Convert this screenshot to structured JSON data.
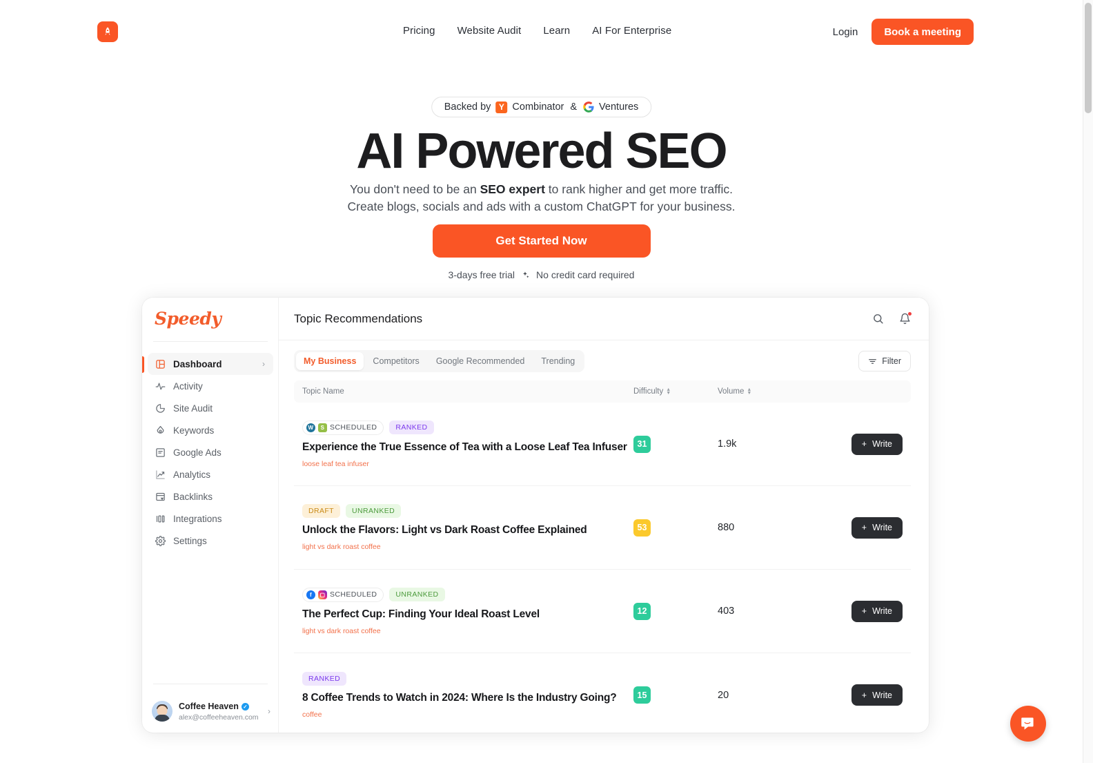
{
  "site": {
    "logo_icon": "rocket-icon"
  },
  "nav": {
    "links": [
      {
        "label": "Pricing"
      },
      {
        "label": "Website Audit"
      },
      {
        "label": "Learn"
      },
      {
        "label": "AI For Enterprise"
      }
    ],
    "login_label": "Login",
    "cta_label": "Book a meeting"
  },
  "hero": {
    "badge_prefix": "Backed by",
    "badge_yc_mark": "Y",
    "badge_yc": "Combinator",
    "badge_amp": "&",
    "badge_google_mark": "G",
    "badge_google": "Ventures",
    "title": "AI Powered SEO",
    "sub_line1_a": "You don't need to be an ",
    "sub_line1_b": "SEO expert",
    "sub_line1_c": " to rank higher and get more traffic.",
    "sub_line2": "Create blogs, socials and ads with a custom ChatGPT for your business.",
    "cta_label": "Get Started Now",
    "trial_left": "3-days free trial",
    "trial_right": "No credit card required",
    "trial_sep_icon": "sparkle-icon"
  },
  "app": {
    "brand": "Speedy",
    "header": {
      "title": "Topic Recommendations",
      "search_icon": "search-icon",
      "bell_icon": "bell-icon"
    },
    "sidebar": {
      "items": [
        {
          "label": "Dashboard",
          "icon": "layout-icon",
          "active": true,
          "chevron": "›"
        },
        {
          "label": "Activity",
          "icon": "pulse-icon",
          "active": false
        },
        {
          "label": "Site Audit",
          "icon": "pie-chart-icon",
          "active": false
        },
        {
          "label": "Keywords",
          "icon": "flame-icon",
          "active": false
        },
        {
          "label": "Google Ads",
          "icon": "document-icon",
          "active": false
        },
        {
          "label": "Analytics",
          "icon": "trending-up-icon",
          "active": false
        },
        {
          "label": "Backlinks",
          "icon": "link-card-icon",
          "active": false
        },
        {
          "label": "Integrations",
          "icon": "columns-icon",
          "active": false
        },
        {
          "label": "Settings",
          "icon": "gear-icon",
          "active": false
        }
      ],
      "profile": {
        "name": "Coffee Heaven",
        "email": "alex@coffeeheaven.com",
        "verified": true,
        "chevron": "›"
      }
    },
    "tabs": [
      {
        "label": "My Business",
        "active": true
      },
      {
        "label": "Competitors",
        "active": false
      },
      {
        "label": "Google Recommended",
        "active": false
      },
      {
        "label": "Trending",
        "active": false
      }
    ],
    "filter_label": "Filter",
    "table": {
      "columns": {
        "topic": "Topic Name",
        "difficulty": "Difficulty",
        "volume": "Volume"
      },
      "write_label": "Write",
      "rows": [
        {
          "platforms": [
            "wordpress",
            "shopify"
          ],
          "scheduled_label": "SCHEDULED",
          "status": "RANKED",
          "status_type": "ranked",
          "title": "Experience the True Essence of Tea with a Loose Leaf Tea Infuser",
          "keyword": "loose leaf tea infuser",
          "difficulty": "31",
          "difficulty_color": "#2ECC9B",
          "volume": "1.9k"
        },
        {
          "platforms": [],
          "draft_label": "DRAFT",
          "status": "UNRANKED",
          "status_type": "unranked",
          "title": "Unlock the Flavors: Light vs Dark Roast Coffee Explained",
          "keyword": "light vs dark roast coffee",
          "difficulty": "53",
          "difficulty_color": "#FBC92C",
          "volume": "880"
        },
        {
          "platforms": [
            "facebook",
            "instagram"
          ],
          "scheduled_label": "SCHEDULED",
          "status": "UNRANKED",
          "status_type": "unranked",
          "title": "The Perfect Cup: Finding Your Ideal Roast Level",
          "keyword": "light vs dark roast coffee",
          "difficulty": "12",
          "difficulty_color": "#2ECC9B",
          "volume": "403"
        },
        {
          "platforms": [],
          "status": "RANKED",
          "status_type": "ranked",
          "title": "8 Coffee Trends to Watch in 2024: Where Is the Industry Going?",
          "keyword": "coffee",
          "difficulty": "15",
          "difficulty_color": "#2ECC9B",
          "volume": "20"
        }
      ]
    }
  },
  "chat_widget": {
    "icon": "chat-bubble-icon"
  },
  "colors": {
    "brand_orange": "#FA5525",
    "dark_button": "#2b2d31",
    "green": "#2ECC9B",
    "yellow": "#FBC92C",
    "purple": "#7c3aed"
  }
}
